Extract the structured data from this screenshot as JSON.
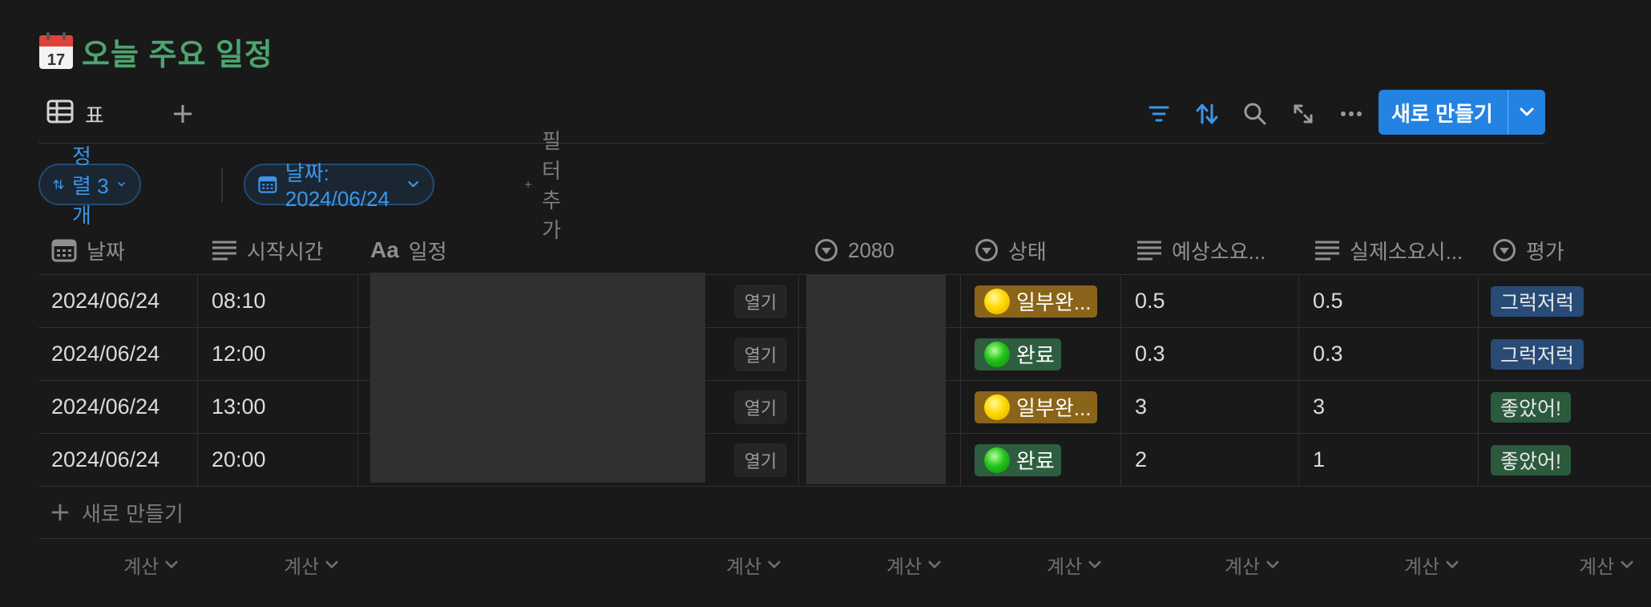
{
  "page": {
    "title": "오늘 주요 일정",
    "title_color": "#4ba56e",
    "emoji": "calendar-17"
  },
  "view": {
    "tab_label": "표",
    "add_view_icon": "plus-icon"
  },
  "toolbar": {
    "icons": [
      "filter-icon",
      "sort-icon",
      "search-icon",
      "expand-icon",
      "more-icon"
    ],
    "new_label": "새로 만들기",
    "accent": "#2383e2"
  },
  "filters": {
    "sort_label": "정렬 3개",
    "date_label": "날짜: 2024/06/24",
    "add_filter_label": "필터 추가"
  },
  "columns": {
    "date": "날짜",
    "start": "시작시간",
    "event": "일정",
    "event_prefix": "Aa",
    "c2080": "2080",
    "status": "상태",
    "expected": "예상소요...",
    "actual": "실제소요시...",
    "rating": "평가"
  },
  "open_label": "열기",
  "rows": [
    {
      "date": "2024/06/24",
      "start": "08:10",
      "status": "일부완...",
      "status_kind": "partial",
      "expected": "0.5",
      "actual": "0.5",
      "rating": "그럭저럭",
      "rating_color": "blue"
    },
    {
      "date": "2024/06/24",
      "start": "12:00",
      "status": "완료",
      "status_kind": "done",
      "expected": "0.3",
      "actual": "0.3",
      "rating": "그럭저럭",
      "rating_color": "blue"
    },
    {
      "date": "2024/06/24",
      "start": "13:00",
      "status": "일부완...",
      "status_kind": "partial",
      "expected": "3",
      "actual": "3",
      "rating": "좋았어!",
      "rating_color": "green"
    },
    {
      "date": "2024/06/24",
      "start": "20:00",
      "status": "완료",
      "status_kind": "done",
      "expected": "2",
      "actual": "1",
      "rating": "좋았어!",
      "rating_color": "green"
    }
  ],
  "new_row_label": "새로 만들기",
  "calc_label": "계산"
}
